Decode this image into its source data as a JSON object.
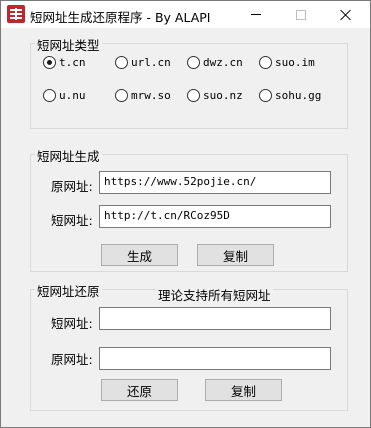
{
  "window": {
    "title": "短网址生成还原程序 - By ALAPI"
  },
  "type_group": {
    "title": "短网址类型",
    "options": [
      {
        "label": "t.cn",
        "checked": true
      },
      {
        "label": "url.cn",
        "checked": false
      },
      {
        "label": "dwz.cn",
        "checked": false
      },
      {
        "label": "suo.im",
        "checked": false
      },
      {
        "label": "u.nu",
        "checked": false
      },
      {
        "label": "mrw.so",
        "checked": false
      },
      {
        "label": "suo.nz",
        "checked": false
      },
      {
        "label": "sohu.gg",
        "checked": false
      }
    ]
  },
  "generate_group": {
    "title": "短网址生成",
    "original_label": "原网址:",
    "original_value": "https://www.52pojie.cn/",
    "short_label": "短网址:",
    "short_value": "http://t.cn/RCoz95D",
    "generate_button": "生成",
    "copy_button": "复制"
  },
  "restore_group": {
    "title": "短网址还原",
    "note": "理论支持所有短网址",
    "short_label": "短网址:",
    "short_value": "",
    "original_label": "原网址:",
    "original_value": "",
    "restore_button": "还原",
    "copy_button": "复制"
  }
}
